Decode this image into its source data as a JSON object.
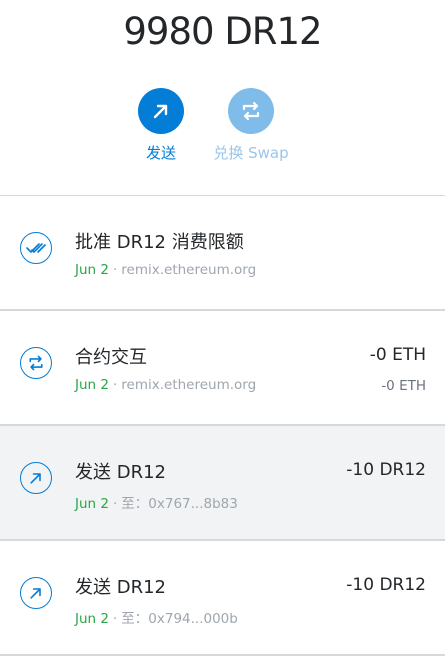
{
  "balance": "9980 DR12",
  "actions": {
    "send_label": "发送",
    "swap_label": "兑换 Swap"
  },
  "transactions": [
    {
      "title": "批准 DR12 消费限额",
      "date": "Jun 2",
      "separator": "·",
      "detail": "remix.ethereum.org",
      "amount": "",
      "sub_amount": "",
      "icon": "approve-check-icon"
    },
    {
      "title": "合约交互",
      "date": "Jun 2",
      "separator": "·",
      "detail": "remix.ethereum.org",
      "amount": "-0 ETH",
      "sub_amount": "-0 ETH",
      "icon": "swap-arrows-icon"
    },
    {
      "title": "发送 DR12",
      "date": "Jun 2",
      "separator": "·",
      "detail": "至：0x767...8b83",
      "amount": "-10 DR12",
      "sub_amount": "",
      "icon": "send-arrow-icon"
    },
    {
      "title": "发送 DR12",
      "date": "Jun 2",
      "separator": "·",
      "detail": "至：0x794...000b",
      "amount": "-10 DR12",
      "sub_amount": "",
      "icon": "send-arrow-icon"
    }
  ],
  "colors": {
    "primary": "#037dd6",
    "primary_disabled": "#80bcea",
    "date_green": "#28a745",
    "hover_bg": "#f2f3f4",
    "divider": "#d6d9dc"
  }
}
